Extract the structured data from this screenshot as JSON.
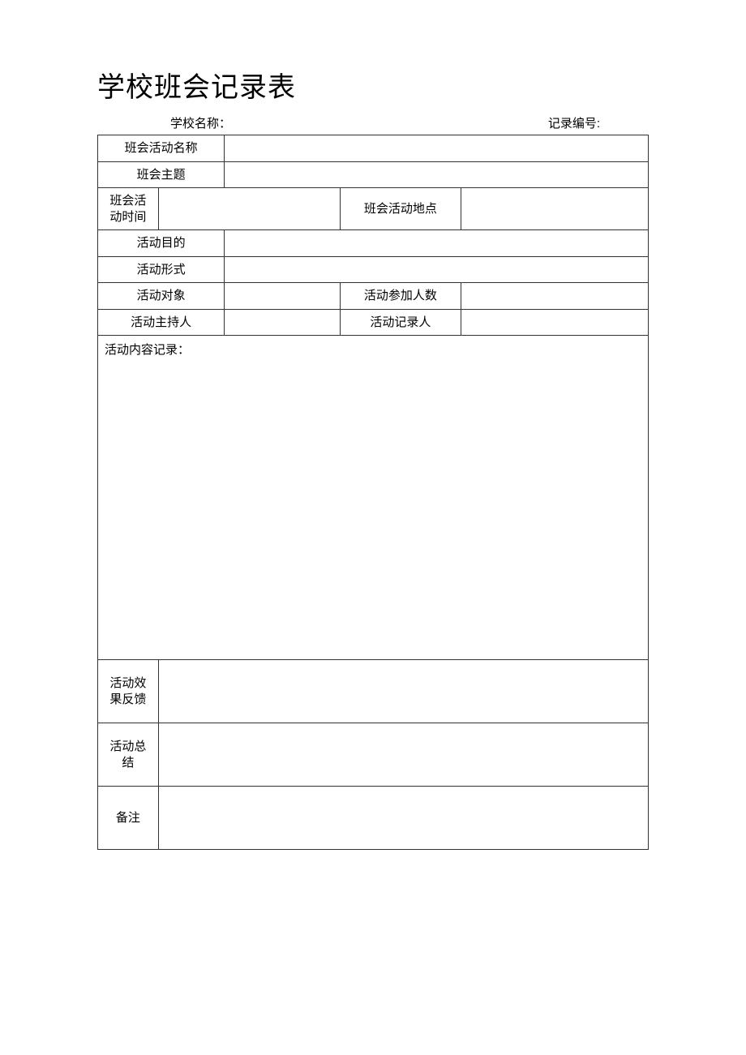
{
  "title": "学校班会记录表",
  "meta": {
    "school_label": "学校名称：",
    "record_no_label": "记录编号:"
  },
  "rows": {
    "activity_name": "班会活动名称",
    "theme": "班会主题",
    "time": "班会活动时间",
    "location": "班会活动地点",
    "purpose": "活动目的",
    "form": "活动形式",
    "target": "活动对象",
    "participants": "活动参加人数",
    "host": "活动主持人",
    "recorder": "活动记录人",
    "content": "活动内容记录：",
    "feedback": "活动效果反馈",
    "summary": "活动总结",
    "remark": "备注"
  }
}
